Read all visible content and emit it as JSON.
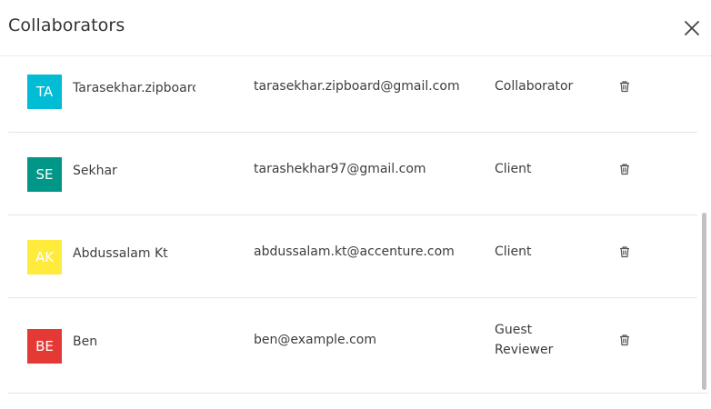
{
  "dialog": {
    "title": "Collaborators"
  },
  "collaborators": [
    {
      "initials": "TA",
      "name": "Tarasekhar.zipboarc",
      "email": "tarasekhar.zipboard@gmail.com",
      "role": "Collaborator",
      "avatar_color": "#00bcd4"
    },
    {
      "initials": "SE",
      "name": "Sekhar",
      "email": "tarashekhar97@gmail.com",
      "role": "Client",
      "avatar_color": "#009688"
    },
    {
      "initials": "AK",
      "name": "Abdussalam Kt",
      "email": "abdussalam.kt@accenture.com",
      "role": "Client",
      "avatar_color": "#ffeb3b"
    },
    {
      "initials": "BE",
      "name": "Ben",
      "email": "ben@example.com",
      "role": "Guest Reviewer",
      "avatar_color": "#e53935"
    }
  ],
  "icons": {
    "close": "close-icon",
    "delete": "trash-icon"
  }
}
